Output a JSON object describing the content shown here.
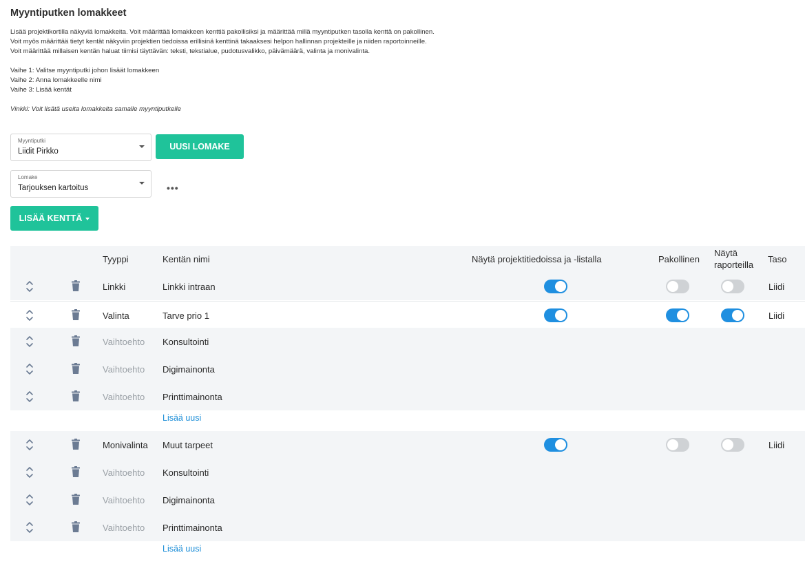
{
  "page": {
    "title": "Myyntiputken lomakkeet",
    "description": [
      "Lisää projektikortilla näkyviä lomakkeita. Voit määrittää lomakkeen kenttiä pakollisiksi ja määrittää millä myyntiputken tasolla kenttä on pakollinen.",
      "Voit myös määrittää tietyt kentät näkyviin projektien tiedoissa erillisinä kenttinä takaaksesi helpon hallinnan projekteille ja niiden raportoinneille.",
      "Voit määrittää millaisen kentän haluat tiimisi täyttävän: teksti, tekstialue, pudotusvalikko, päivämäärä, valinta ja monivalinta."
    ],
    "steps": [
      "Vaihe 1: Valitse myyntiputki johon lisäät lomakkeen",
      "Vaihe 2: Anna lomakkeelle nimi",
      "Vaihe 3: Lisää kentät"
    ],
    "tip": "Vinkki: Voit lisätä useita lomakkeita samalle myyntiputkelle"
  },
  "controls": {
    "pipeline": {
      "label": "Myyntiputki",
      "value": "Liidit Pirkko"
    },
    "new_form_button": "UUSI LOMAKE",
    "form": {
      "label": "Lomake",
      "value": "Tarjouksen kartoitus"
    },
    "more": "•••",
    "add_field_button": "LISÄÄ KENTTÄ"
  },
  "table": {
    "headers": {
      "type": "Tyyppi",
      "name": "Kentän nimi",
      "show_in_project": "Näytä projektitiedoissa ja -listalla",
      "required": "Pakollinen",
      "show_in_reports_1": "Näytä",
      "show_in_reports_2": "raporteilla",
      "level": "Taso"
    },
    "rows": [
      {
        "type": "Linkki",
        "name": "Linkki intraan",
        "show": true,
        "required": false,
        "reports": false,
        "level": "Liidi"
      },
      {
        "type": "Valinta",
        "name": "Tarve prio 1",
        "show": true,
        "required": true,
        "reports": true,
        "level": "Liidi"
      },
      {
        "type": "Vaihtoehto",
        "name": "Konsultointi"
      },
      {
        "type": "Vaihtoehto",
        "name": "Digimainonta"
      },
      {
        "type": "Vaihtoehto",
        "name": "Printtimainonta"
      },
      {
        "type": "Monivalinta",
        "name": "Muut tarpeet",
        "show": true,
        "required": false,
        "reports": false,
        "level": "Liidi"
      },
      {
        "type": "Vaihtoehto",
        "name": "Konsultointi"
      },
      {
        "type": "Vaihtoehto",
        "name": "Digimainonta"
      },
      {
        "type": "Vaihtoehto",
        "name": "Printtimainonta"
      }
    ],
    "add_new_link": "Lisää uusi"
  },
  "colors": {
    "accent_green": "#1fc39a",
    "toggle_on": "#1f8fe0",
    "toggle_off": "#cfd2d5",
    "link": "#1e8fd8"
  }
}
